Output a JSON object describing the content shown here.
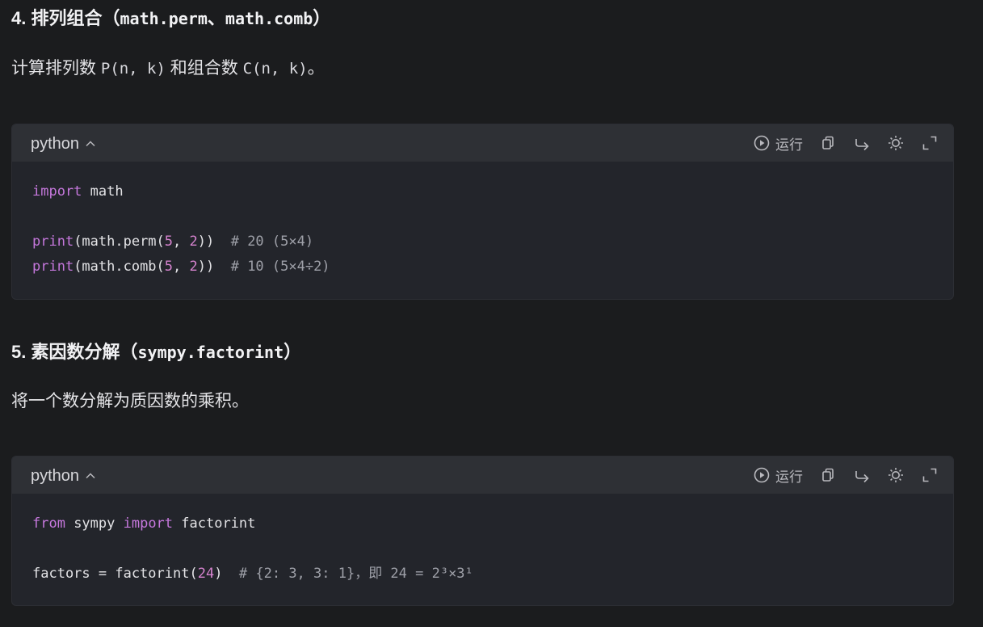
{
  "section4": {
    "num": "4.",
    "title": "排列组合",
    "paren_open": "（",
    "code1": "math.perm",
    "sep": "、",
    "code2": "math.comb",
    "paren_close": "）",
    "desc_a": "计算排列数",
    "desc_code1": "P(n, k)",
    "desc_b": "和组合数",
    "desc_code2": "C(n, k)",
    "desc_c": "。"
  },
  "code1": {
    "language": "python",
    "run_label": "运行",
    "lines": {
      "l1_kw": "import",
      "l1_rest": " math",
      "l3_fn": "print",
      "l3_a": "(math.perm(",
      "l3_n1": "5",
      "l3_b": ", ",
      "l3_n2": "2",
      "l3_c": "))  ",
      "l3_cm": "# 20 (5×4)",
      "l4_fn": "print",
      "l4_a": "(math.comb(",
      "l4_n1": "5",
      "l4_b": ", ",
      "l4_n2": "2",
      "l4_c": "))  ",
      "l4_cm": "# 10 (5×4÷2)"
    }
  },
  "section5": {
    "num": "5.",
    "title": "素因数分解",
    "paren_open": "（",
    "code": "sympy.factorint",
    "paren_close": "）",
    "desc": "将一个数分解为质因数的乘积。"
  },
  "code2": {
    "language": "python",
    "run_label": "运行",
    "lines": {
      "l1_kw1": "from",
      "l1_mid": " sympy ",
      "l1_kw2": "import",
      "l1_rest": " factorint",
      "l3_a": "factors = factorint(",
      "l3_n": "24",
      "l3_b": ")  ",
      "l3_cm": "# {2: 3, 3: 1}，即 24 = 2³×3¹"
    }
  },
  "icons": {
    "lang_toggle": "chevron-up-icon",
    "run": "play-circle-icon",
    "copy": "copy-icon",
    "share": "share-arrow-icon",
    "theme": "sun-icon",
    "expand": "expand-icon"
  }
}
